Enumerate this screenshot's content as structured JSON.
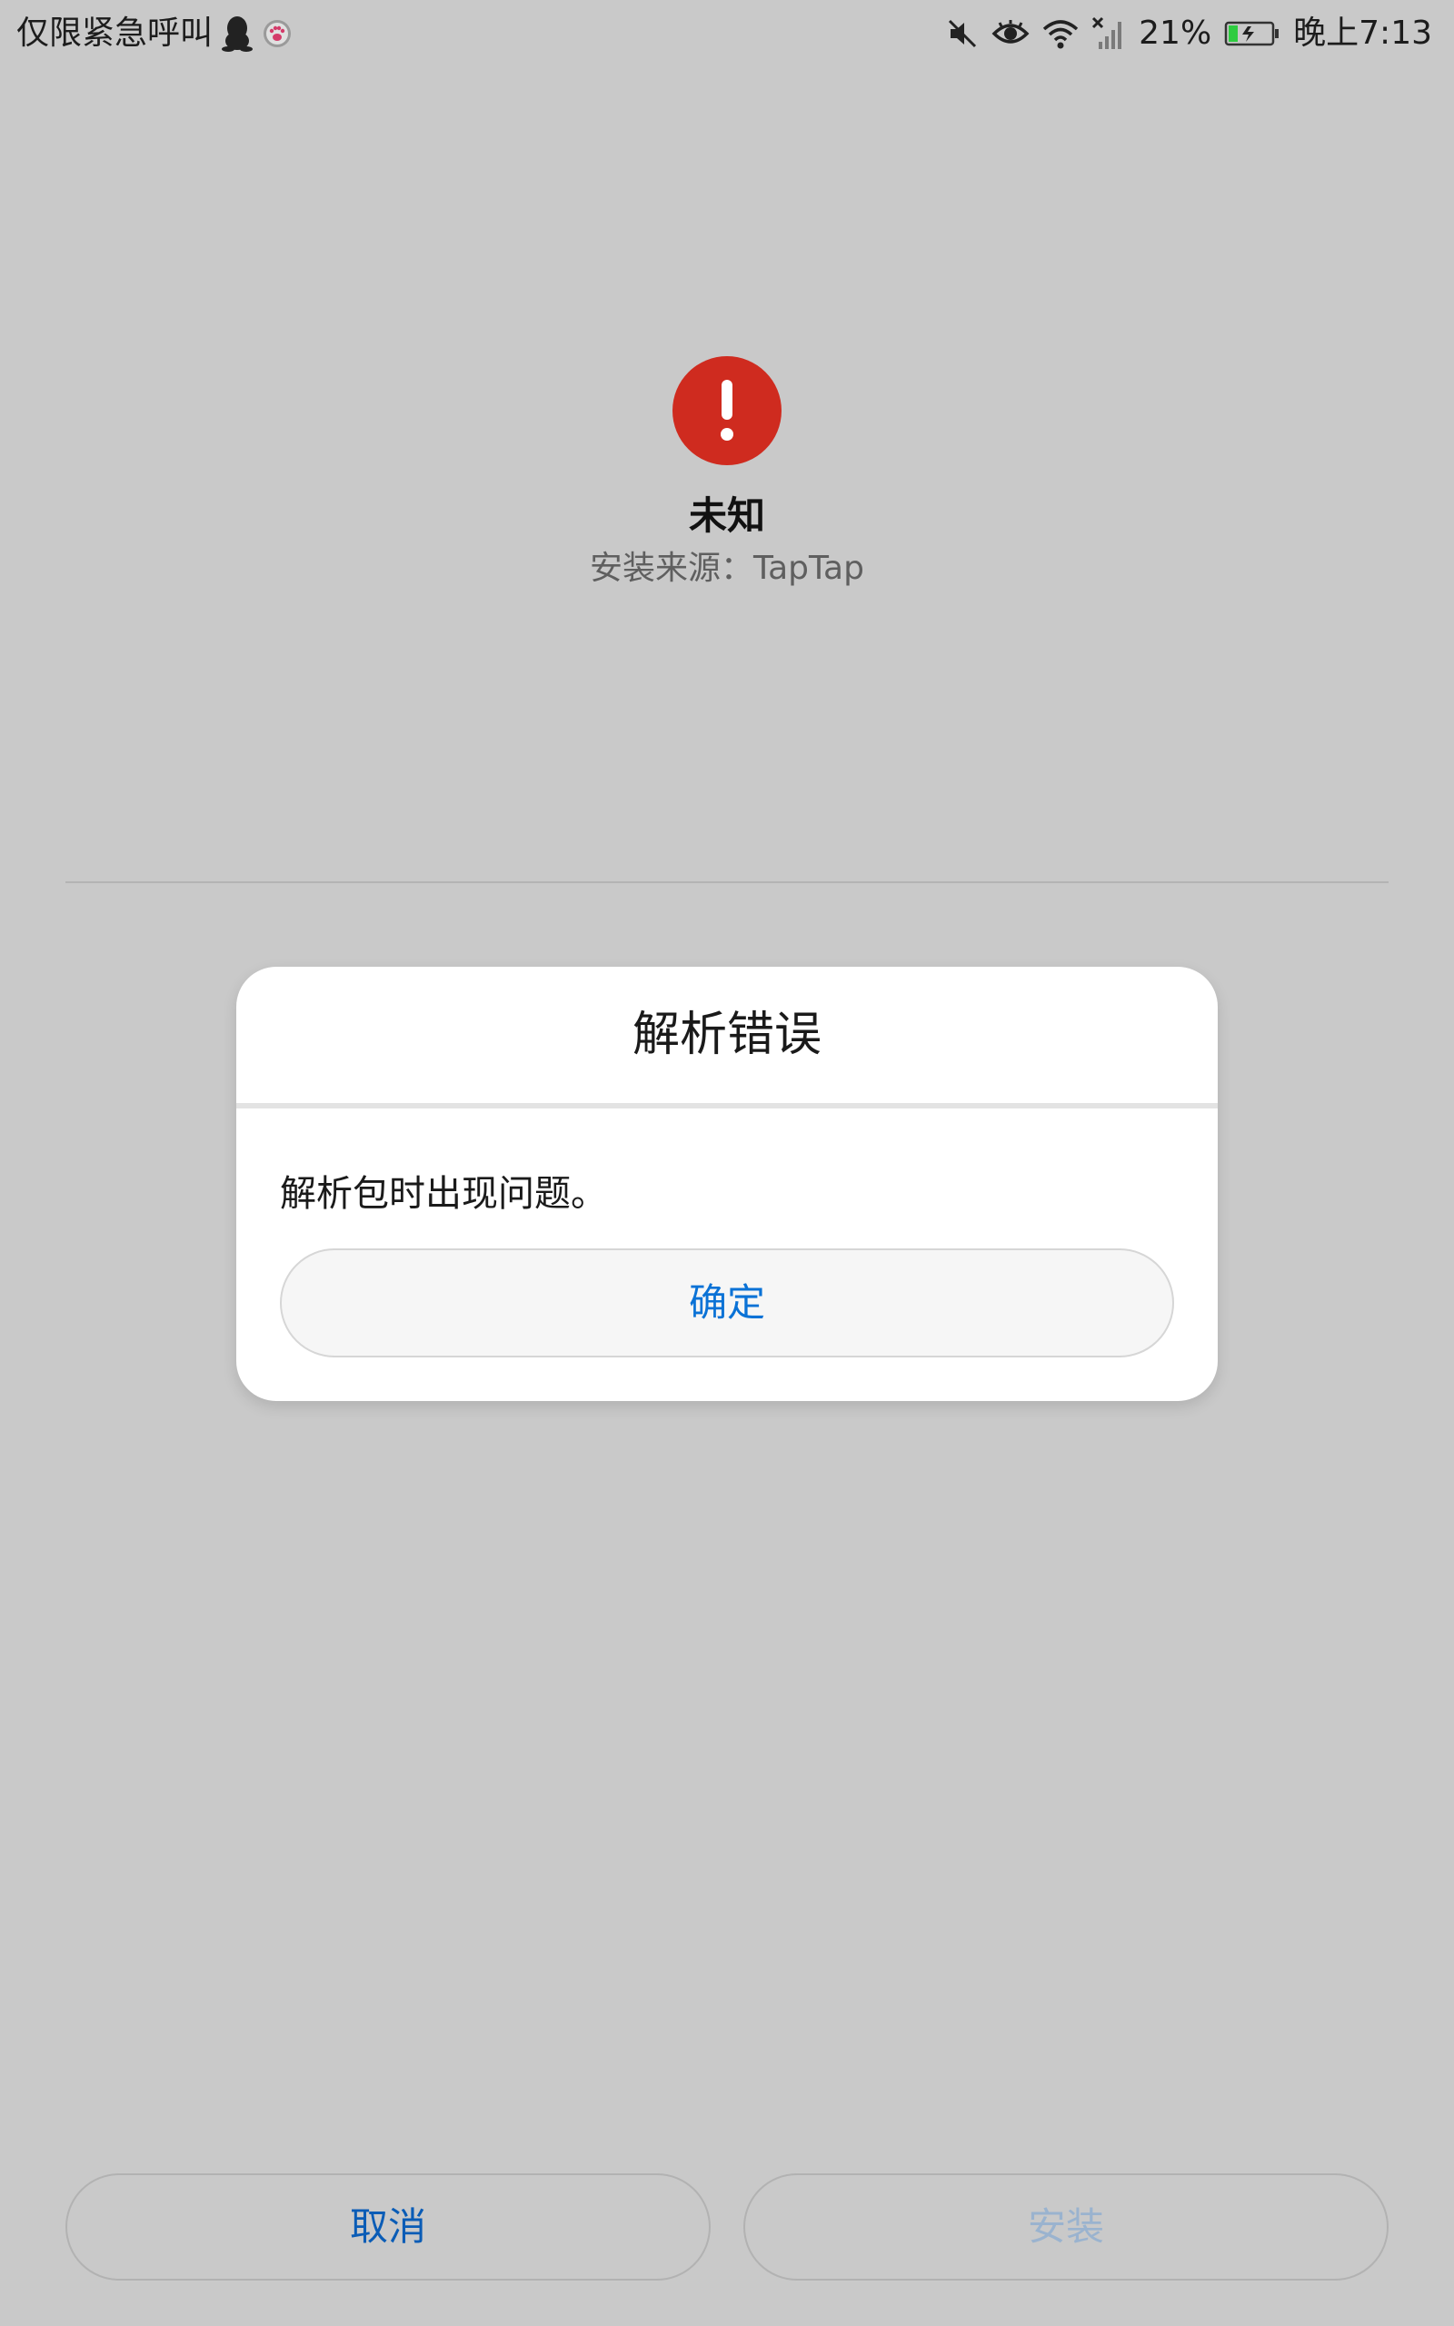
{
  "status_bar": {
    "carrier": "仅限紧急呼叫",
    "battery_percent": "21%",
    "time": "晚上7:13",
    "icons_left": [
      "qq-penguin-icon",
      "paw-icon"
    ],
    "icons_right": [
      "mute-icon",
      "eye-comfort-icon",
      "wifi-icon",
      "no-signal-icon",
      "battery-charging-icon"
    ],
    "battery_level": 0.21,
    "battery_color": "#2ecc40"
  },
  "package": {
    "icon": "error-exclamation-icon",
    "icon_color": "#cf2b1f",
    "name": "未知",
    "source_label": "安装来源：TapTap"
  },
  "dialog": {
    "title": "解析错误",
    "message": "解析包时出现问题。",
    "ok_label": "确定"
  },
  "actions": {
    "cancel_label": "取消",
    "install_label": "安装"
  },
  "colors": {
    "background": "#c9c9c9",
    "accent": "#0a72d6",
    "disabled_text": "#9ab3cf"
  }
}
